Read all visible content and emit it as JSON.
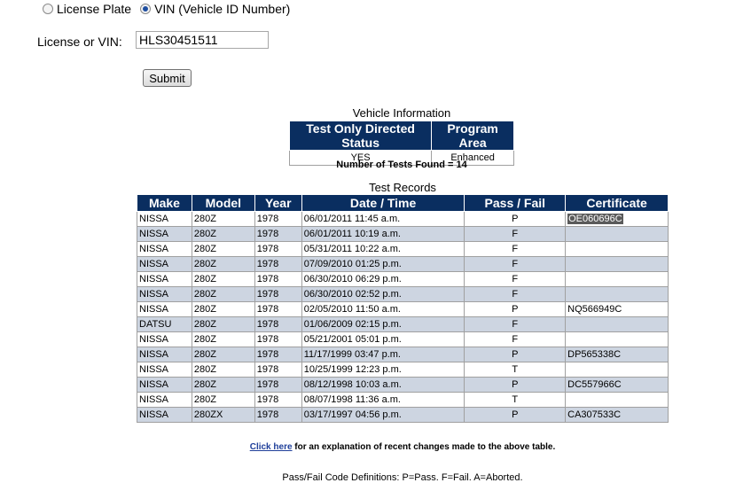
{
  "search": {
    "option_plate": "License Plate",
    "option_vin": "VIN (Vehicle ID Number)",
    "selected": "vin",
    "field_label": "License or VIN:",
    "field_value": "HLS30451511",
    "submit_label": "Submit"
  },
  "vehicle_info": {
    "caption": "Vehicle Information",
    "headers": [
      "Test Only Directed Status",
      "Program Area"
    ],
    "row": [
      "YES",
      "Enhanced"
    ]
  },
  "tests_found": "Number of Tests Found = 14",
  "records": {
    "caption": "Test Records",
    "headers": [
      "Make",
      "Model",
      "Year",
      "Date / Time",
      "Pass / Fail",
      "Certificate"
    ],
    "rows": [
      [
        "NISSA",
        "280Z",
        "1978",
        "06/01/2011 11:45 a.m.",
        "P",
        "OE060696C"
      ],
      [
        "NISSA",
        "280Z",
        "1978",
        "06/01/2011 10:19 a.m.",
        "F",
        ""
      ],
      [
        "NISSA",
        "280Z",
        "1978",
        "05/31/2011 10:22 a.m.",
        "F",
        ""
      ],
      [
        "NISSA",
        "280Z",
        "1978",
        "07/09/2010 01:25 p.m.",
        "F",
        ""
      ],
      [
        "NISSA",
        "280Z",
        "1978",
        "06/30/2010 06:29 p.m.",
        "F",
        ""
      ],
      [
        "NISSA",
        "280Z",
        "1978",
        "06/30/2010 02:52 p.m.",
        "F",
        ""
      ],
      [
        "NISSA",
        "280Z",
        "1978",
        "02/05/2010 11:50 a.m.",
        "P",
        "NQ566949C"
      ],
      [
        "DATSU",
        "280Z",
        "1978",
        "01/06/2009 02:15 p.m.",
        "F",
        ""
      ],
      [
        "NISSA",
        "280Z",
        "1978",
        "05/21/2001 05:01 p.m.",
        "F",
        ""
      ],
      [
        "NISSA",
        "280Z",
        "1978",
        "11/17/1999 03:47 p.m.",
        "P",
        "DP565338C"
      ],
      [
        "NISSA",
        "280Z",
        "1978",
        "10/25/1999 12:23 p.m.",
        "T",
        ""
      ],
      [
        "NISSA",
        "280Z",
        "1978",
        "08/12/1998 10:03 a.m.",
        "P",
        "DC557966C"
      ],
      [
        "NISSA",
        "280Z",
        "1978",
        "08/07/1998 11:36 a.m.",
        "T",
        ""
      ],
      [
        "NISSA",
        "280ZX",
        "1978",
        "03/17/1997 04:56 p.m.",
        "P",
        "CA307533C"
      ]
    ]
  },
  "note": {
    "link_text": "Click here",
    "rest_text": " for an explanation of recent changes made to the above table."
  },
  "codes_text": "Pass/Fail Code Definitions: P=Pass. F=Fail. A=Aborted."
}
